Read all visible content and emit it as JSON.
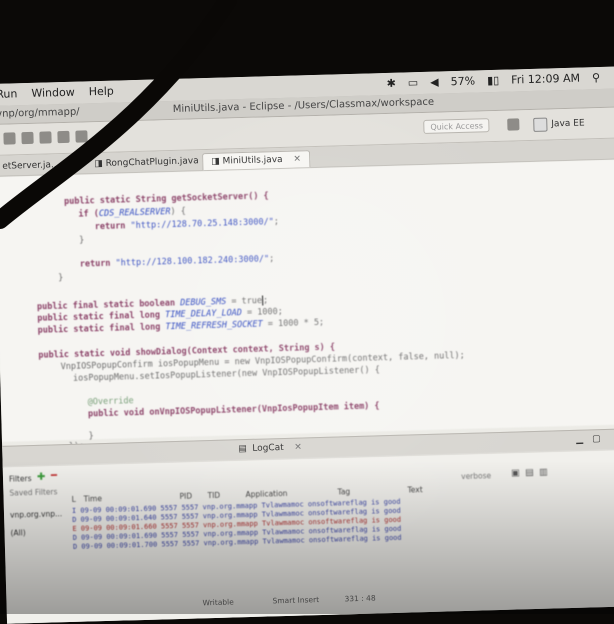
{
  "menubar": {
    "items": [
      "Run",
      "Window",
      "Help"
    ],
    "battery": "57%",
    "clock": "Fri 12:09 AM"
  },
  "window": {
    "path_fragment": "/vnp/org/mmapp/",
    "title": "MiniUtils.java - Eclipse - /Users/Classmax/workspace"
  },
  "toolbar": {
    "quick_access_placeholder": "Quick Access",
    "perspective_label": "Java EE"
  },
  "editor_tabs": [
    {
      "label": "etServer.ja..."
    },
    {
      "label": "RongChatPlugin.java"
    },
    {
      "label": "MiniUtils.java",
      "active": true
    }
  ],
  "code": {
    "l1": "public static String getSocketServer() {",
    "l2a": "if (",
    "l2b": "CDS_REALSERVER",
    "l2c": ") {",
    "l3a": "return ",
    "l3b": "\"http://128.70.25.148:3000/\"",
    "l3c": ";",
    "l4": "}",
    "l5a": "return ",
    "l5b": "\"http://128.100.182.240:3000/\"",
    "l5c": ";",
    "l6": "}",
    "l7a": "public final static boolean ",
    "l7b": "DEBUG_SMS",
    "l7c": " = true",
    "l8a": "public static final long ",
    "l8b": "TIME_DELAY_LOAD",
    "l8c": " = 1000;",
    "l9a": "public static final long ",
    "l9b": "TIME_REFRESH_SOCKET",
    "l9c": " = 1000 * 5;",
    "l10": "public static void showDialog(Context context, String s) {",
    "l11": "VnpIOSPopupConfirm iosPopupMenu = new VnpIOSPopupConfirm(context, false, null);",
    "l12": "iosPopupMenu.setIosPopupListener(new VnpIOSPopupListener() {",
    "l13": "@Override",
    "l14": "public void onVnpIOSPopupListener(VnpIosPopupItem item) {",
    "l15": "}",
    "l16": "});"
  },
  "bottom_panel": {
    "tab_label": "LogCat",
    "devices_label": "Filters",
    "filter_hint": "Saved Filters",
    "device_item": "vnp.org.vnp...",
    "selected_item": "(All)",
    "search_hint": "verbose",
    "columns": [
      "L",
      "Time",
      "PID",
      "TID",
      "Application",
      "Tag",
      "Text"
    ],
    "rows": [
      "I  09-09 00:09:01.690 5557  5557  vnp.org.mmapp  Tvlawmamoc  onsoftwareflag is good",
      "D  09-09 00:09:01.640 5557  5557  vnp.org.mmapp  Tvlawmamoc  onsoftwareflag is good",
      "E  09-09 00:09:01.660 5557  5557  vnp.org.mmapp  Tvlawmamoc  onsoftwareflag is good",
      "D  09-09 00:09:01.690 5557  5557  vnp.org.mmapp  Tvlawmamoc  onsoftwareflag is good",
      "D  09-09 00:09:01.700 5557  5557  vnp.org.mmapp  Tvlawmamoc  onsoftwareflag is good"
    ],
    "status": [
      "Writable",
      "Smart Insert",
      "331 : 48"
    ]
  },
  "colors": {
    "keyword": "#8a3f66",
    "string": "#3b52c2",
    "field": "#2d48c0",
    "log_error": "#b03030",
    "log_debug": "#3a45a8"
  }
}
